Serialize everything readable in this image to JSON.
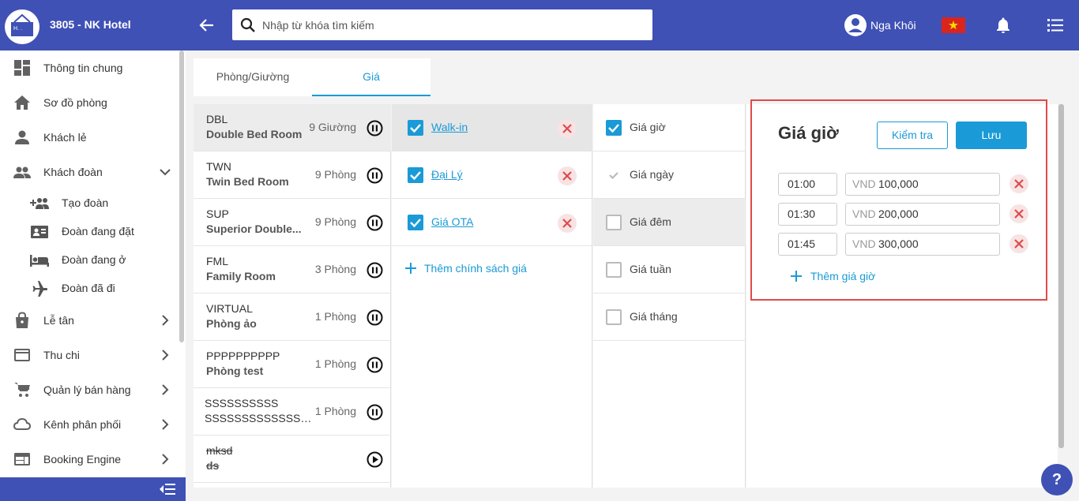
{
  "header": {
    "hotel_name": "3805 - NK Hotel",
    "logo_text": "H. .",
    "search_placeholder": "Nhập từ khóa tìm kiếm",
    "user_name": "Nga Khôi"
  },
  "sidebar": {
    "items": [
      {
        "label": "Thông tin chung",
        "icon": "dashboard-icon"
      },
      {
        "label": "Sơ đồ phòng",
        "icon": "home-icon"
      },
      {
        "label": "Khách lẻ",
        "icon": "person-icon"
      },
      {
        "label": "Khách đoàn",
        "icon": "group-icon",
        "expanded": true
      },
      {
        "label": "Lễ tân",
        "icon": "shopping-bag-icon"
      },
      {
        "label": "Thu chi",
        "icon": "credit-card-icon"
      },
      {
        "label": "Quản lý bán hàng",
        "icon": "cart-icon"
      },
      {
        "label": "Kênh phân phối",
        "icon": "cloud-icon"
      },
      {
        "label": "Booking Engine",
        "icon": "web-icon"
      }
    ],
    "sub_items": [
      {
        "label": "Tạo đoàn",
        "icon": "group-add-icon"
      },
      {
        "label": "Đoàn đang đặt",
        "icon": "contact-card-icon"
      },
      {
        "label": "Đoàn đang ở",
        "icon": "bed-icon"
      },
      {
        "label": "Đoàn đã đi",
        "icon": "airplane-icon"
      }
    ]
  },
  "tabs": [
    {
      "label": "Phòng/Giường",
      "active": false
    },
    {
      "label": "Giá",
      "active": true
    }
  ],
  "rooms": [
    {
      "code": "DBL",
      "name": "Double Bed Room",
      "count": "9 Giường",
      "state": "pause"
    },
    {
      "code": "TWN",
      "name": "Twin Bed Room",
      "count": "9 Phòng",
      "state": "pause"
    },
    {
      "code": "SUP",
      "name": "Superior Double...",
      "count": "9 Phòng",
      "state": "pause"
    },
    {
      "code": "FML",
      "name": "Family Room",
      "count": "3 Phòng",
      "state": "pause"
    },
    {
      "code": "VIRTUAL",
      "name": "Phòng ảo",
      "count": "1 Phòng",
      "state": "pause"
    },
    {
      "code": "PPPPPPPPPP",
      "name": "Phòng test",
      "count": "1 Phòng",
      "state": "pause"
    },
    {
      "code": "SSSSSSSSSS",
      "name": "SSSSSSSSSSSSSSS...",
      "count": "1 Phòng",
      "state": "pause"
    },
    {
      "code": "mksd",
      "name": "ds",
      "count": "",
      "state": "play"
    }
  ],
  "policies": [
    {
      "label": "Walk-in",
      "checked": true
    },
    {
      "label": "Đại Lý",
      "checked": true
    },
    {
      "label": "Giá OTA",
      "checked": true
    }
  ],
  "add_policy_label": "Thêm chính sách giá",
  "price_types": [
    {
      "label": "Giá giờ",
      "state": "checked"
    },
    {
      "label": "Giá ngày",
      "state": "disabled"
    },
    {
      "label": "Giá đêm",
      "state": "empty"
    },
    {
      "label": "Giá tuần",
      "state": "empty"
    },
    {
      "label": "Giá tháng",
      "state": "empty"
    }
  ],
  "detail": {
    "title": "Giá giờ",
    "check_label": "Kiểm tra",
    "save_label": "Lưu",
    "rows": [
      {
        "time": "01:00",
        "currency": "VND",
        "price": "100,000"
      },
      {
        "time": "01:30",
        "currency": "VND",
        "price": "200,000"
      },
      {
        "time": "01:45",
        "currency": "VND",
        "price": "300,000"
      }
    ],
    "add_label": "Thêm giá giờ"
  },
  "help_label": "?",
  "colors": {
    "primary": "#3f51b5",
    "accent": "#1a9ad6",
    "danger": "#e04a4a"
  }
}
